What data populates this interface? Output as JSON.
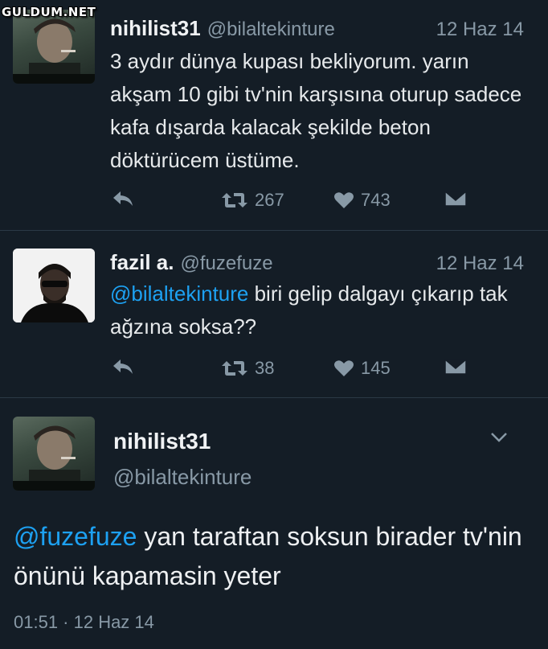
{
  "watermark": "GULDUM.NET",
  "tweets": [
    {
      "name": "nihilist31",
      "handle": "@bilaltekinture",
      "date": "12 Haz 14",
      "text": "3 aydır dünya kupası bekliyorum. yarın akşam 10 gibi tv'nin karşısına oturup sadece kafa dışarda kalacak şekilde beton döktürücem üstüme.",
      "retweets": "267",
      "likes": "743"
    },
    {
      "name": "fazil a.",
      "handle": "@fuzefuze",
      "date": "12 Haz 14",
      "mention": "@bilaltekinture",
      "text": " biri gelip dalgayı çıkarıp tak ağzına soksa??",
      "retweets": "38",
      "likes": "145"
    }
  ],
  "main_tweet": {
    "name": "nihilist31",
    "handle": "@bilaltekinture",
    "mention": "@fuzefuze",
    "text": " yan taraftan soksun birader tv'nin önünü kapamasin yeter",
    "timestamp": "01:51 · 12 Haz 14"
  },
  "icons": {
    "reply": "reply-icon",
    "retweet": "retweet-icon",
    "like": "heart-icon",
    "dm": "envelope-icon",
    "menu": "chevron-down-icon"
  },
  "colors": {
    "background": "#141d26",
    "mention": "#1da1f2",
    "muted": "#8899a6"
  }
}
